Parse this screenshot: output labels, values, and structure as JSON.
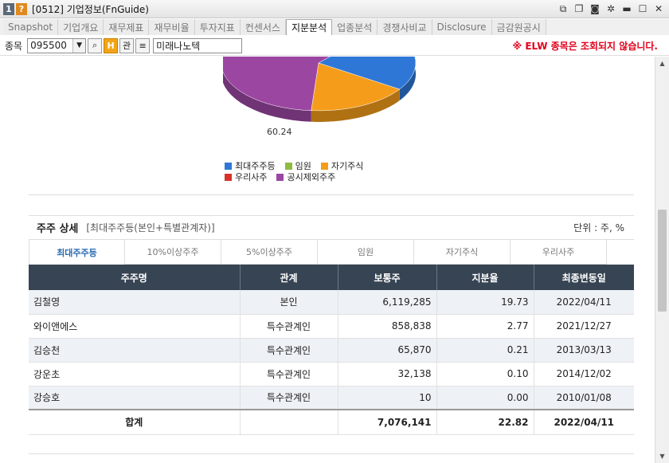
{
  "window": {
    "num": "1",
    "q": "?",
    "title": "[0512] 기업정보(FnGuide)"
  },
  "tabs": [
    "Snapshot",
    "기업개요",
    "재무제표",
    "재무비율",
    "투자지표",
    "컨센서스",
    "지분분석",
    "업종분석",
    "경쟁사비교",
    "Disclosure",
    "금감원공시"
  ],
  "active_tab": "지분분석",
  "search": {
    "label": "종목",
    "code": "095500",
    "kwan": "관",
    "name": "미래나노텍",
    "notice": "※ ELW 종목은 조회되지 않습니다."
  },
  "chart_data": {
    "type": "pie",
    "data_label": "60.24",
    "series": [
      {
        "name": "최대주주등",
        "color": "#2f77d6",
        "value": 22.82
      },
      {
        "name": "자기주식",
        "color": "#f59d1b",
        "value": 16.94
      },
      {
        "name": "공시제외주주",
        "color": "#9b47a2",
        "value": 60.24
      },
      {
        "name": "임원",
        "color": "#8fbb3f",
        "value": 0
      },
      {
        "name": "우리사주",
        "color": "#d8332b",
        "value": 0
      }
    ],
    "legend": {
      "rows": [
        [
          {
            "name": "최대주주등",
            "color": "#2f77d6"
          },
          {
            "name": "임원",
            "color": "#8fbb3f"
          },
          {
            "name": "자기주식",
            "color": "#f59d1b"
          }
        ],
        [
          {
            "name": "우리사주",
            "color": "#d8332b"
          },
          {
            "name": "공시제외주주",
            "color": "#9b47a2"
          }
        ]
      ]
    }
  },
  "section": {
    "title": "주주 상세",
    "subtitle": "[최대주주등(본인+특별관계자)]",
    "unit": "단위 : 주, %"
  },
  "subtabs": [
    "최대주주등",
    "10%이상주주",
    "5%이상주주",
    "임원",
    "자기주식",
    "우리사주"
  ],
  "table": {
    "headers": [
      "주주명",
      "관계",
      "보통주",
      "지분율",
      "최종변동일"
    ],
    "rows": [
      [
        "김철영",
        "본인",
        "6,119,285",
        "19.73",
        "2022/04/11"
      ],
      [
        "와이앤에스",
        "특수관계인",
        "858,838",
        "2.77",
        "2021/12/27"
      ],
      [
        "김승천",
        "특수관계인",
        "65,870",
        "0.21",
        "2013/03/13"
      ],
      [
        "강운초",
        "특수관계인",
        "32,138",
        "0.10",
        "2014/12/02"
      ],
      [
        "강승호",
        "특수관계인",
        "10",
        "0.00",
        "2010/01/08"
      ]
    ],
    "total": [
      "합계",
      "7,076,141",
      "22.82",
      "2022/04/11"
    ]
  }
}
